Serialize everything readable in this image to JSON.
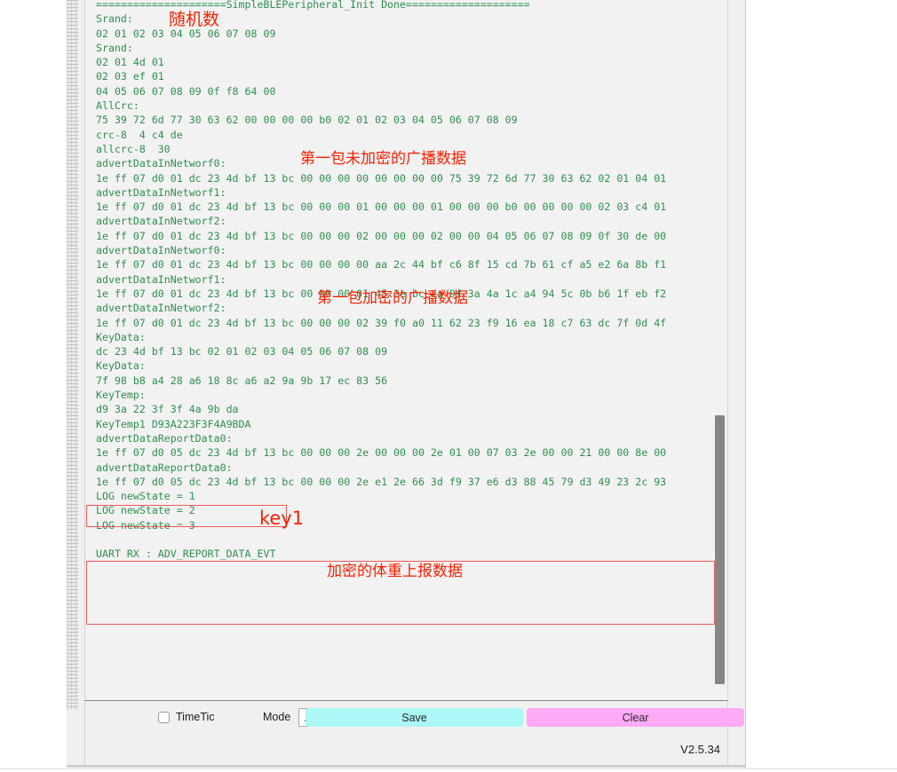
{
  "window": {
    "version_label": "V2.5.34"
  },
  "log": {
    "text": "=====================SimpleBLEPeripheral_Init Done====================\nSrand:\n02 01 02 03 04 05 06 07 08 09\nSrand:\n02 01 4d 01\n02 03 ef 01\n04 05 06 07 08 09 0f f8 64 00\nAllCrc:\n75 39 72 6d 77 30 63 62 00 00 00 00 b0 02 01 02 03 04 05 06 07 08 09\ncrc-8  4 c4 de\nallcrc-8  30\nadvertDataInNetworf0:\n1e ff 07 d0 01 dc 23 4d bf 13 bc 00 00 00 00 00 00 00 00 75 39 72 6d 77 30 63 62 02 01 04 01\nadvertDataInNetworf1:\n1e ff 07 d0 01 dc 23 4d bf 13 bc 00 00 00 01 00 00 00 01 00 00 00 b0 00 00 00 00 02 03 c4 01\nadvertDataInNetworf2:\n1e ff 07 d0 01 dc 23 4d bf 13 bc 00 00 00 02 00 00 00 02 00 00 04 05 06 07 08 09 0f 30 de 00\nadvertDataInNetworf0:\n1e ff 07 d0 01 dc 23 4d bf 13 bc 00 00 00 00 aa 2c 44 bf c6 8f 15 cd 7b 61 cf a5 e2 6a 8b f1\nadvertDataInNetworf1:\n1e ff 07 d0 01 dc 23 4d bf 13 bc 00 00 00 01 45 2e bc ca 9f 3a 4a 1c a4 94 5c 0b b6 1f eb f2\nadvertDataInNetworf2:\n1e ff 07 d0 01 dc 23 4d bf 13 bc 00 00 00 02 39 f0 a0 11 62 23 f9 16 ea 18 c7 63 dc 7f 0d 4f\nKeyData:\ndc 23 4d bf 13 bc 02 01 02 03 04 05 06 07 08 09\nKeyData:\n7f 98 b8 a4 28 a6 18 8c a6 a2 9a 9b 17 ec 83 56\nKeyTemp:\nd9 3a 22 3f 3f 4a 9b da\nKeyTemp1 D93A223F3F4A9BDA\nadvertDataReportData0:\n1e ff 07 d0 05 dc 23 4d bf 13 bc 00 00 00 2e 00 00 00 2e 01 00 07 03 2e 00 00 21 00 00 8e 00\nadvertDataReportData0:\n1e ff 07 d0 05 dc 23 4d bf 13 bc 00 00 00 2e e1 2e 66 3d f9 37 e6 d3 88 45 79 d3 49 23 2c 93\nLOG newState = 1\nLOG newState = 2\nLOG newState = 3\n\nUART RX : ADV_REPORT_DATA_EVT\n"
  },
  "toolbar": {
    "timetic_label": "TimeTic",
    "mode_label": "Mode",
    "mode_value": "ASCII",
    "save_label": "Save",
    "clear_label": "Clear"
  },
  "annotations": {
    "srand": "随机数",
    "first_plain_packet": "第一包未加密的广播数据",
    "first_encrypted_packet": "第一包加密的广播数据",
    "key1": "key1",
    "encrypted_weight_report": "加密的体重上报数据"
  },
  "colors": {
    "log_text": "#2f8f4e",
    "annotation": "#fa2000",
    "annotation_box": "#ef5a5a",
    "save_button": "#aaf7f5",
    "clear_button": "#ffaaf7"
  }
}
